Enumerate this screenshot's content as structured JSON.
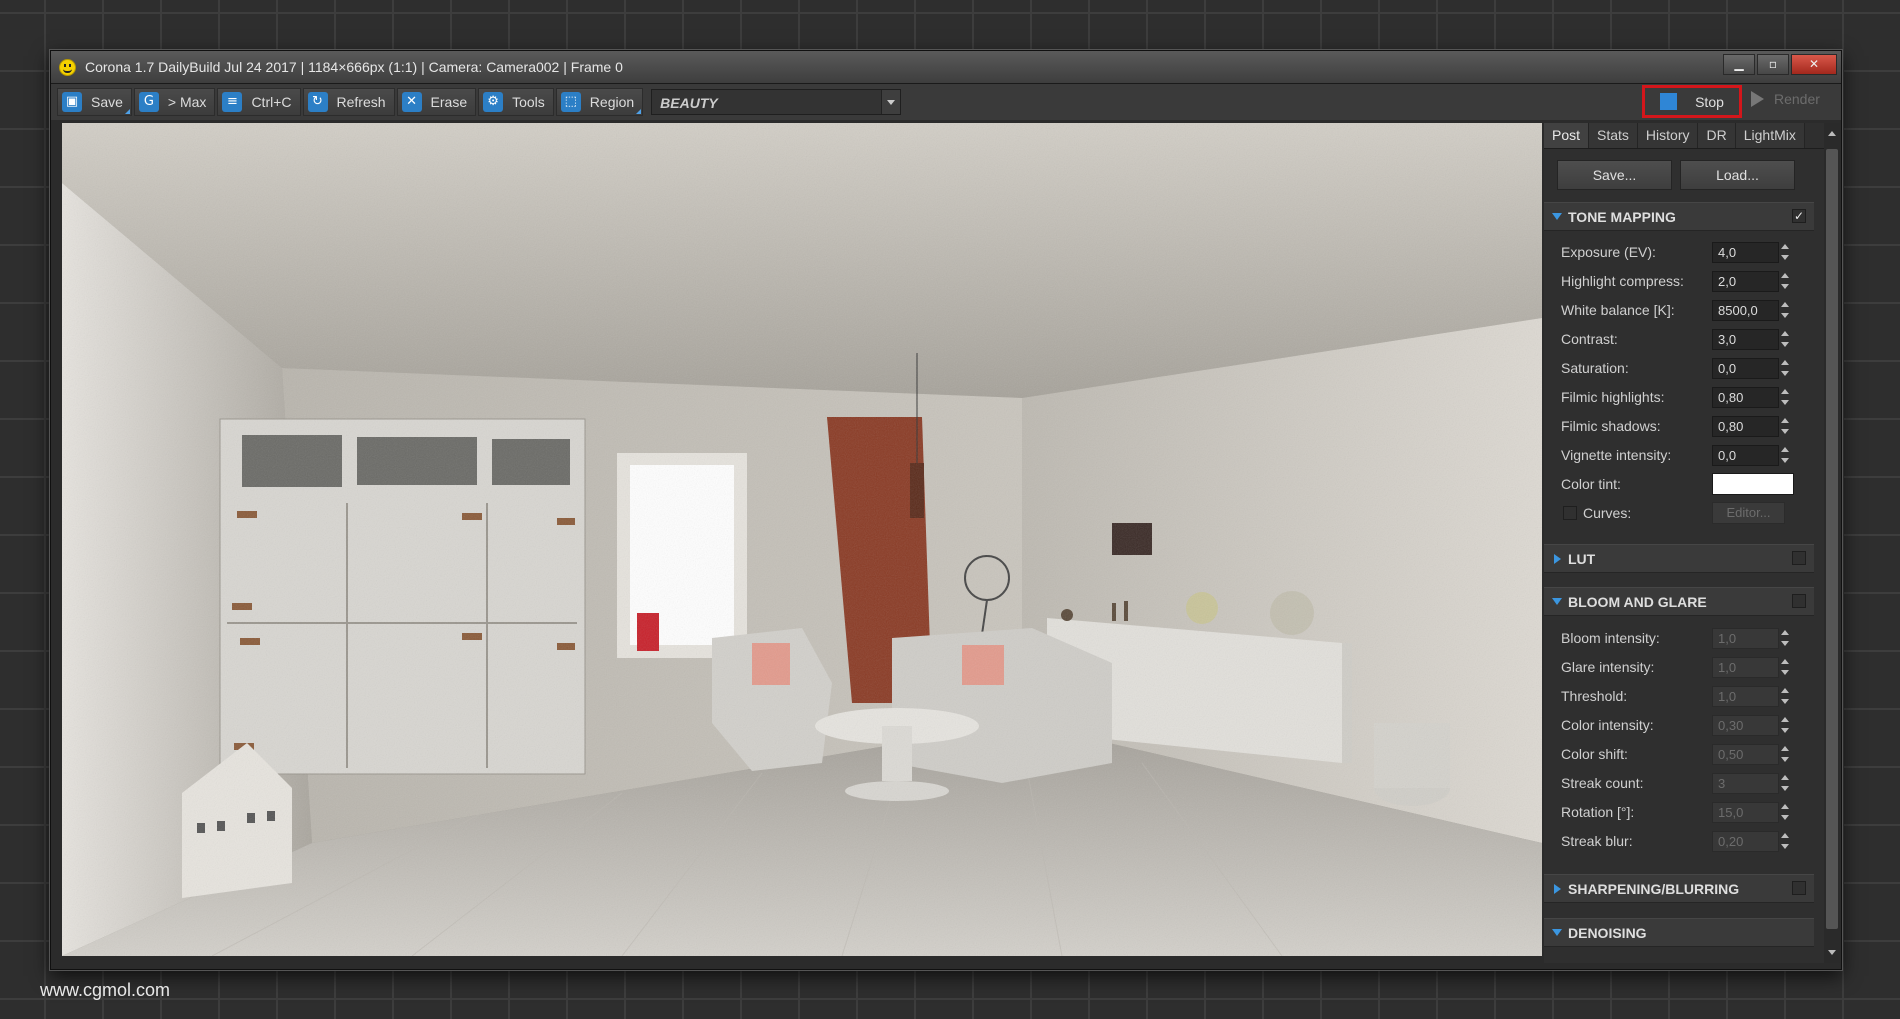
{
  "window": {
    "title": "Corona 1.7 DailyBuild Jul 24 2017 | 1184×666px (1:1) | Camera: Camera002 | Frame 0",
    "controls": {
      "minimize": "▁",
      "maximize": "▫",
      "close": "✕"
    }
  },
  "toolbar": {
    "save": "Save",
    "max": "> Max",
    "copy": "Ctrl+C",
    "refresh": "Refresh",
    "erase": "Erase",
    "tools": "Tools",
    "region": "Region",
    "pass": "BEAUTY",
    "stop": "Stop",
    "render": "Render",
    "stop_highlight_color": "#d4161b",
    "accent_color": "#2f86d6"
  },
  "panel": {
    "tabs": [
      "Post",
      "Stats",
      "History",
      "DR",
      "LightMix"
    ],
    "active_tab": "Post",
    "save_button": "Save...",
    "load_button": "Load...",
    "tone_mapping": {
      "title": "TONE MAPPING",
      "enabled": "✓",
      "exposure_label": "Exposure (EV):",
      "exposure_value": "4,0",
      "highlight_label": "Highlight compress:",
      "highlight_value": "2,0",
      "white_balance_label": "White balance [K]:",
      "white_balance_value": "8500,0",
      "contrast_label": "Contrast:",
      "contrast_value": "3,0",
      "saturation_label": "Saturation:",
      "saturation_value": "0,0",
      "filmic_highlights_label": "Filmic highlights:",
      "filmic_highlights_value": "0,80",
      "filmic_shadows_label": "Filmic shadows:",
      "filmic_shadows_value": "0,80",
      "vignette_label": "Vignette intensity:",
      "vignette_value": "0,0",
      "color_tint_label": "Color tint:",
      "color_tint_value": "#ffffff",
      "curves_label": "Curves:",
      "editor_button": "Editor..."
    },
    "lut": {
      "title": "LUT"
    },
    "bloom_and_glare": {
      "title": "BLOOM AND GLARE",
      "bloom_intensity_label": "Bloom intensity:",
      "bloom_intensity_value": "1,0",
      "glare_intensity_label": "Glare intensity:",
      "glare_intensity_value": "1,0",
      "threshold_label": "Threshold:",
      "threshold_value": "1,0",
      "color_intensity_label": "Color intensity:",
      "color_intensity_value": "0,30",
      "color_shift_label": "Color shift:",
      "color_shift_value": "0,50",
      "streak_count_label": "Streak count:",
      "streak_count_value": "3",
      "rotation_label": "Rotation [°]:",
      "rotation_value": "15,0",
      "streak_blur_label": "Streak blur:",
      "streak_blur_value": "0,20"
    },
    "sharpening": {
      "title": "SHARPENING/BLURRING"
    },
    "denoising": {
      "title": "DENOISING"
    }
  },
  "watermark": "www.cgmol.com"
}
